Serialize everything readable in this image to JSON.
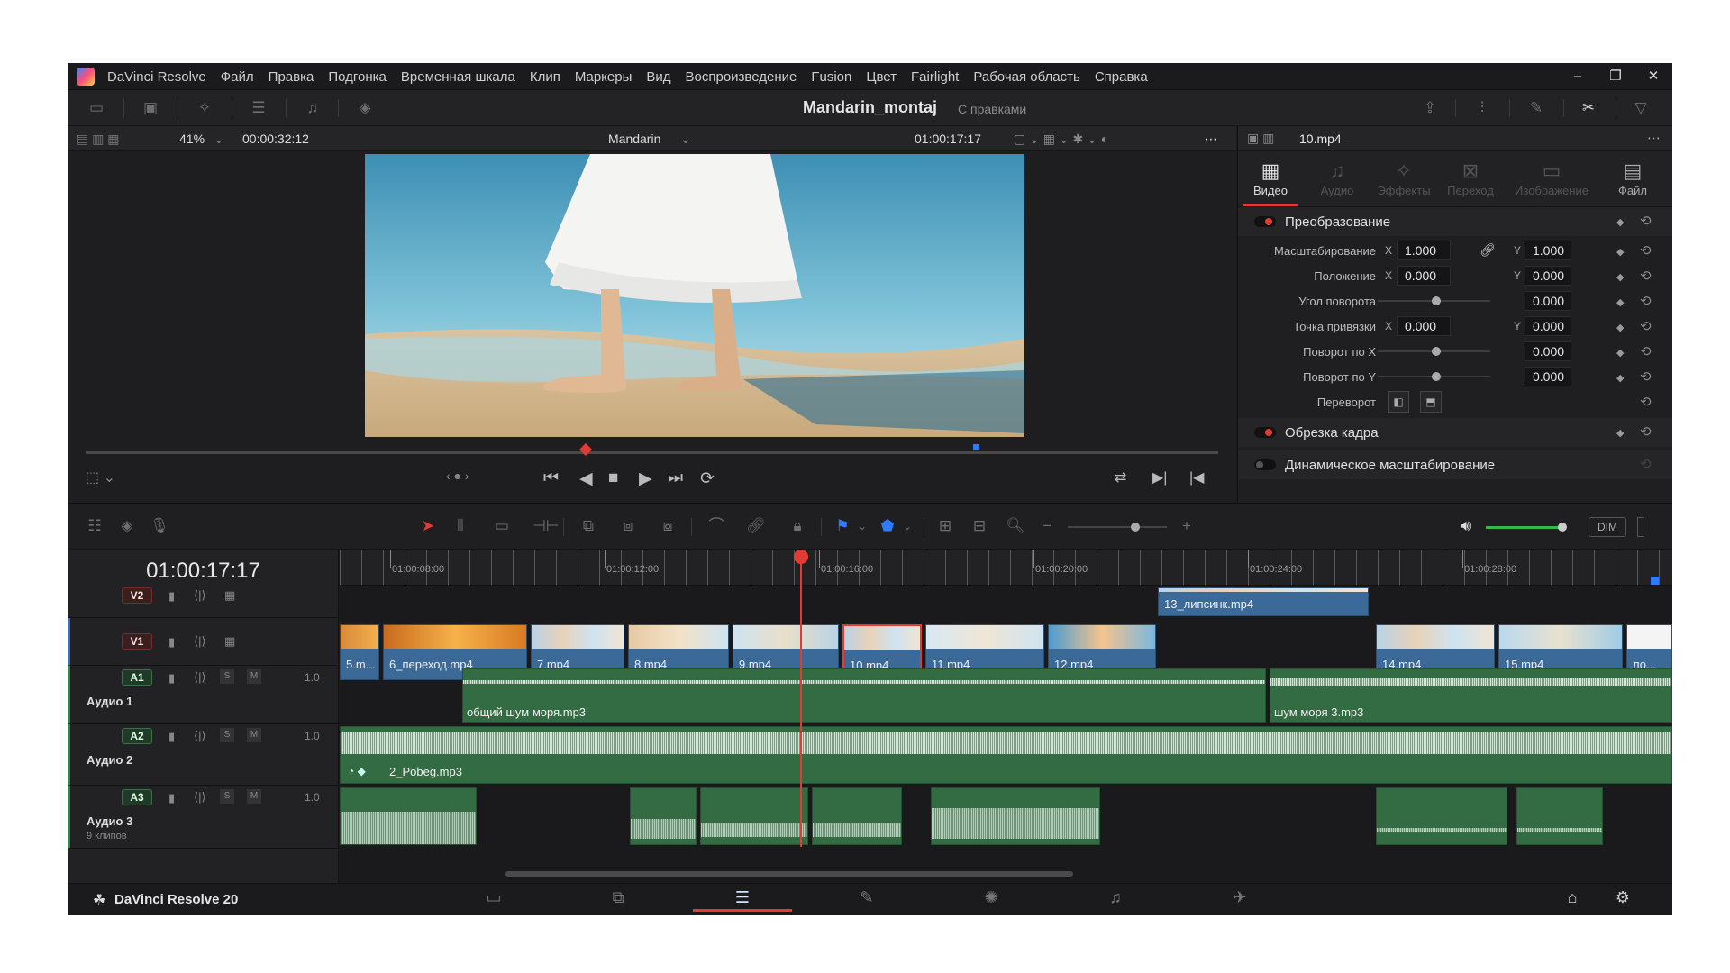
{
  "menubar": {
    "app": "DaVinci Resolve",
    "items": [
      "Файл",
      "Правка",
      "Подгонка",
      "Временная шкала",
      "Клип",
      "Маркеры",
      "Вид",
      "Воспроизведение",
      "Fusion",
      "Цвет",
      "Fairlight",
      "Рабочая область",
      "Справка"
    ],
    "min": "–",
    "max": "❐",
    "close": "✕"
  },
  "project": {
    "title": "Mandarin_montaj",
    "status": "С правками"
  },
  "viewer": {
    "zoom": "41%",
    "duration": "00:00:32:12",
    "timeline_name": "Mandarin",
    "timecode": "01:00:17:17"
  },
  "inspector": {
    "clip": "10.mp4",
    "tabs": [
      {
        "label": "Видео",
        "icon": "video-icon"
      },
      {
        "label": "Аудио",
        "icon": "audio-icon"
      },
      {
        "label": "Эффекты",
        "icon": "effects-icon"
      },
      {
        "label": "Переход",
        "icon": "transition-icon"
      },
      {
        "label": "Изображение",
        "icon": "image-icon"
      },
      {
        "label": "Файл",
        "icon": "file-icon"
      }
    ],
    "sections": {
      "transform": "Преобразование",
      "crop": "Обрезка кадра",
      "dynamic_zoom": "Динамическое масштабирование"
    },
    "params": {
      "zoom": {
        "label": "Масштабирование",
        "x": "1.000",
        "y": "1.000"
      },
      "position": {
        "label": "Положение",
        "x": "0.000",
        "y": "0.000"
      },
      "rotation": {
        "label": "Угол поворота",
        "value": "0.000"
      },
      "anchor": {
        "label": "Точка привязки",
        "x": "0.000",
        "y": "0.000"
      },
      "pitch": {
        "label": "Поворот по X",
        "value": "0.000"
      },
      "yaw": {
        "label": "Поворот по Y",
        "value": "0.000"
      },
      "flip": {
        "label": "Переворот"
      }
    },
    "x_label": "X",
    "y_label": "Y"
  },
  "timeline": {
    "timecode": "01:00:17:17",
    "ruler": [
      "01:00:08:00",
      "01:00:12:00",
      "01:00:16:00",
      "01:00:20:00",
      "01:00:24:00",
      "01:00:28:00"
    ],
    "tracks": {
      "v2": {
        "badge": "V2"
      },
      "v1": {
        "badge": "V1"
      },
      "a1": {
        "badge": "A1",
        "name": "Аудио 1",
        "vol": "1.0"
      },
      "a2": {
        "badge": "A2",
        "name": "Аудио 2",
        "vol": "1.0"
      },
      "a3": {
        "badge": "A3",
        "name": "Аудио 3",
        "sub": "9 клипов",
        "vol": "1.0"
      }
    },
    "v2_clips": [
      "13_липсинк.mp4"
    ],
    "v1_clips": [
      "5.m...",
      "6_переход.mp4",
      "7.mp4",
      "8.mp4",
      "9.mp4",
      "10.mp4",
      "11.mp4",
      "12.mp4",
      "14.mp4",
      "15.mp4",
      "ло..."
    ],
    "a1_clips": [
      "общий шум моря.mp3",
      "шум моря 3.mp3"
    ],
    "a2_clips": [
      "2_Pobeg.mp3"
    ],
    "solo": "S",
    "mute": "M",
    "dim": "DIM"
  },
  "pagebar": {
    "brand": "DaVinci Resolve 20"
  }
}
